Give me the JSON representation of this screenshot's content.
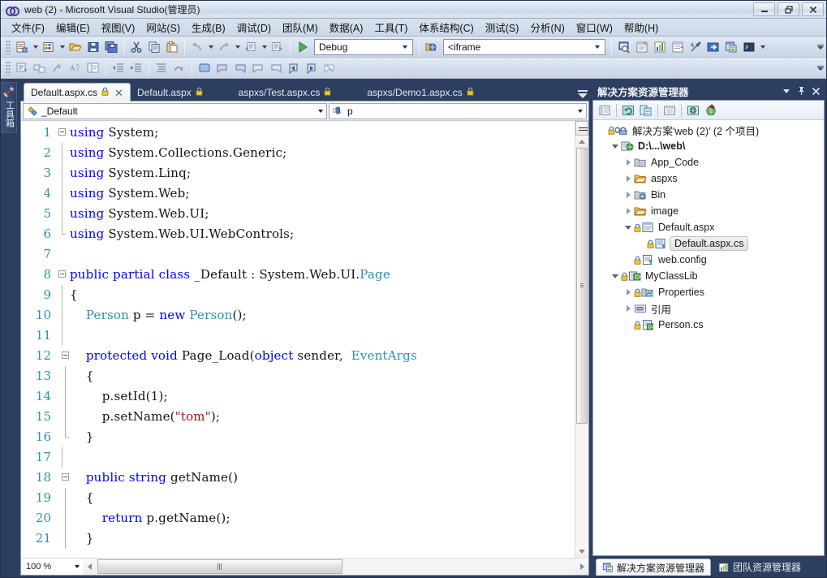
{
  "window": {
    "title": "web (2) - Microsoft Visual Studio(管理员)",
    "logo_icon": "visual-studio-infinity-logo",
    "buttons": [
      {
        "name": "minimize",
        "icon": "minimize-icon",
        "label": "—"
      },
      {
        "name": "restore",
        "icon": "restore-icon",
        "label": "❐"
      },
      {
        "name": "close",
        "icon": "close-icon",
        "label": "✕"
      }
    ]
  },
  "menubar": {
    "items": [
      {
        "label": "文件(F)",
        "name": "menu-file"
      },
      {
        "label": "编辑(E)",
        "name": "menu-edit"
      },
      {
        "label": "视图(V)",
        "name": "menu-view"
      },
      {
        "label": "网站(S)",
        "name": "menu-website"
      },
      {
        "label": "生成(B)",
        "name": "menu-build"
      },
      {
        "label": "调试(D)",
        "name": "menu-debug"
      },
      {
        "label": "团队(M)",
        "name": "menu-team"
      },
      {
        "label": "数据(A)",
        "name": "menu-data"
      },
      {
        "label": "工具(T)",
        "name": "menu-tools"
      },
      {
        "label": "体系结构(C)",
        "name": "menu-architecture"
      },
      {
        "label": "测试(S)",
        "name": "menu-test"
      },
      {
        "label": "分析(N)",
        "name": "menu-analyze"
      },
      {
        "label": "窗口(W)",
        "name": "menu-window"
      },
      {
        "label": "帮助(H)",
        "name": "menu-help"
      }
    ]
  },
  "toolbar_main": {
    "configuration_combo": {
      "value": "Debug",
      "name": "solution-configuration-combo"
    },
    "target_combo": {
      "value": "<iframe",
      "name": "target-browser-combo"
    },
    "icons": [
      "new-project-icon",
      "new-website-icon",
      "open-file-icon",
      "save-icon",
      "save-all-icon",
      "cut-icon",
      "copy-icon",
      "paste-icon",
      "undo-icon",
      "redo-icon",
      "navigate-backward-icon",
      "navigate-forward-icon",
      "start-debugging-icon",
      "view-in-browser-icon",
      "find-in-files-icon",
      "properties-window-icon",
      "toolbox-icon",
      "object-browser-icon",
      "tools-options-icon",
      "step-into-icon",
      "solution-explorer-icon",
      "command-window-icon"
    ]
  },
  "toolbar_secondary": {
    "icons": [
      "display-all-members-icon",
      "insert-snippet-icon",
      "surround-with-icon",
      "comment-selection-icon",
      "uncomment-selection-icon",
      "decrease-indent-icon",
      "increase-indent-icon",
      "toggle-bookmark-icon",
      "clear-bookmarks-icon",
      "toggle-all-outlining-icon",
      "previous-bookmark-icon",
      "next-bookmark-icon",
      "previous-bookmark-in-folder-icon",
      "next-bookmark-in-folder-icon",
      "previous-bookmark-in-document-icon",
      "next-bookmark-in-document-icon",
      "clear-all-bookmarks-icon"
    ]
  },
  "document_tabs": {
    "items": [
      {
        "label": "Default.aspx.cs",
        "active": true,
        "locked": true,
        "closable": true,
        "name": "tab-default-aspx-cs"
      },
      {
        "label": "Default.aspx",
        "active": false,
        "locked": true,
        "closable": false,
        "name": "tab-default-aspx"
      },
      {
        "label": "aspxs/Test.aspx.cs",
        "active": false,
        "locked": true,
        "closable": false,
        "name": "tab-test-aspx-cs"
      },
      {
        "label": "aspxs/Demo1.aspx.cs",
        "active": false,
        "locked": true,
        "closable": false,
        "name": "tab-demo1-aspx-cs"
      }
    ],
    "close_label": "✕",
    "overflow_icon": "tab-overflow-icon"
  },
  "navigation_bar": {
    "type_combo": {
      "value": "_Default",
      "icon": "class-icon",
      "name": "type-navigation-combo"
    },
    "member_combo": {
      "value": "p",
      "icon": "field-icon",
      "name": "member-navigation-combo"
    }
  },
  "editor": {
    "zoom": "100 %",
    "lines": [
      {
        "num": "1",
        "fold": "open-first",
        "tokens": [
          {
            "t": "using",
            "c": "kw"
          },
          {
            "t": " System;",
            "c": "pln"
          }
        ]
      },
      {
        "num": "2",
        "fold": "bar",
        "tokens": [
          {
            "t": "using",
            "c": "kw"
          },
          {
            "t": " System.Collections.Generic;",
            "c": "pln"
          }
        ]
      },
      {
        "num": "3",
        "fold": "bar",
        "tokens": [
          {
            "t": "using",
            "c": "kw"
          },
          {
            "t": " System.Linq;",
            "c": "pln"
          }
        ]
      },
      {
        "num": "4",
        "fold": "bar",
        "tokens": [
          {
            "t": "using",
            "c": "kw"
          },
          {
            "t": " System.Web;",
            "c": "pln"
          }
        ]
      },
      {
        "num": "5",
        "fold": "bar",
        "tokens": [
          {
            "t": "using",
            "c": "kw"
          },
          {
            "t": " System.Web.UI;",
            "c": "pln"
          }
        ]
      },
      {
        "num": "6",
        "fold": "bar-end",
        "tokens": [
          {
            "t": "using",
            "c": "kw"
          },
          {
            "t": " System.Web.UI.WebControls;",
            "c": "pln"
          }
        ]
      },
      {
        "num": "7",
        "fold": "none",
        "tokens": []
      },
      {
        "num": "8",
        "fold": "open",
        "tokens": [
          {
            "t": "public partial class",
            "c": "kw"
          },
          {
            "t": " _Default : System.Web.UI.",
            "c": "pln"
          },
          {
            "t": "Page",
            "c": "type"
          }
        ]
      },
      {
        "num": "9",
        "fold": "bar",
        "tokens": [
          {
            "t": "{",
            "c": "pln"
          }
        ]
      },
      {
        "num": "10",
        "fold": "bar",
        "tokens": [
          {
            "t": "    ",
            "c": "pln"
          },
          {
            "t": "Person",
            "c": "type"
          },
          {
            "t": " p = ",
            "c": "pln"
          },
          {
            "t": "new",
            "c": "kw"
          },
          {
            "t": " ",
            "c": "pln"
          },
          {
            "t": "Person",
            "c": "type"
          },
          {
            "t": "();",
            "c": "pln"
          }
        ]
      },
      {
        "num": "11",
        "fold": "bar",
        "tokens": []
      },
      {
        "num": "12",
        "fold": "open-inner",
        "tokens": [
          {
            "t": "    ",
            "c": "pln"
          },
          {
            "t": "protected void",
            "c": "kw"
          },
          {
            "t": " Page_Load(",
            "c": "pln"
          },
          {
            "t": "object",
            "c": "kw"
          },
          {
            "t": " sender,  ",
            "c": "pln"
          },
          {
            "t": "EventArgs",
            "c": "type"
          }
        ]
      },
      {
        "num": "13",
        "fold": "bar-inner",
        "tokens": [
          {
            "t": "    {",
            "c": "pln"
          }
        ]
      },
      {
        "num": "14",
        "fold": "bar-inner",
        "tokens": [
          {
            "t": "        p.setId(1);",
            "c": "pln"
          }
        ]
      },
      {
        "num": "15",
        "fold": "bar-inner",
        "tokens": [
          {
            "t": "        p.setName(",
            "c": "pln"
          },
          {
            "t": "\"tom\"",
            "c": "str"
          },
          {
            "t": ");",
            "c": "pln"
          }
        ]
      },
      {
        "num": "16",
        "fold": "bar-inner-end",
        "tokens": [
          {
            "t": "    }",
            "c": "pln"
          }
        ]
      },
      {
        "num": "17",
        "fold": "bar",
        "tokens": []
      },
      {
        "num": "18",
        "fold": "open-inner",
        "tokens": [
          {
            "t": "    ",
            "c": "pln"
          },
          {
            "t": "public string",
            "c": "kw"
          },
          {
            "t": " getName()",
            "c": "pln"
          }
        ]
      },
      {
        "num": "19",
        "fold": "bar-inner",
        "tokens": [
          {
            "t": "    {",
            "c": "pln"
          }
        ]
      },
      {
        "num": "20",
        "fold": "bar-inner",
        "tokens": [
          {
            "t": "        ",
            "c": "pln"
          },
          {
            "t": "return",
            "c": "kw"
          },
          {
            "t": " p.getName();",
            "c": "pln"
          }
        ]
      },
      {
        "num": "21",
        "fold": "bar-inner",
        "tokens": [
          {
            "t": "    }",
            "c": "pln"
          }
        ]
      }
    ]
  },
  "solution_explorer": {
    "title": "解决方案资源管理器",
    "header_buttons": [
      {
        "name": "dropdown-button",
        "icon": "chevron-down-icon"
      },
      {
        "name": "auto-hide-button",
        "icon": "pin-icon",
        "label": "⊥"
      },
      {
        "name": "close-button",
        "icon": "close-icon",
        "label": "✕"
      }
    ],
    "toolbar_icons": [
      "properties-icon",
      "refresh-icon",
      "nest-related-files-icon",
      "show-all-files-icon",
      "view-designer-icon",
      "view-in-browser-icon",
      "copy-website-icon",
      "asp-net-configuration-icon"
    ],
    "tree": [
      {
        "label": "解决方案'web (2)' (2 个项目)",
        "depth": 0,
        "expander": "none",
        "icon": "solution-icon",
        "locked": true,
        "bold": false,
        "selected": false
      },
      {
        "label": "D:\\...\\web\\",
        "depth": 1,
        "expander": "open",
        "icon": "web-project-icon",
        "locked": false,
        "bold": true,
        "selected": false
      },
      {
        "label": "App_Code",
        "depth": 2,
        "expander": "closed",
        "icon": "app-code-folder-icon",
        "locked": false,
        "bold": false,
        "selected": false
      },
      {
        "label": "aspxs",
        "depth": 2,
        "expander": "closed",
        "icon": "folder-icon",
        "locked": false,
        "bold": false,
        "selected": false
      },
      {
        "label": "Bin",
        "depth": 2,
        "expander": "closed",
        "icon": "bin-folder-icon",
        "locked": false,
        "bold": false,
        "selected": false
      },
      {
        "label": "image",
        "depth": 2,
        "expander": "closed",
        "icon": "folder-icon",
        "locked": false,
        "bold": false,
        "selected": false
      },
      {
        "label": "Default.aspx",
        "depth": 2,
        "expander": "open",
        "icon": "aspx-file-icon",
        "locked": true,
        "bold": false,
        "selected": false
      },
      {
        "label": "Default.aspx.cs",
        "depth": 3,
        "expander": "none",
        "icon": "csharp-codebehind-icon",
        "locked": true,
        "bold": false,
        "selected": true
      },
      {
        "label": "web.config",
        "depth": 2,
        "expander": "none",
        "icon": "config-file-icon",
        "locked": true,
        "bold": false,
        "selected": false
      },
      {
        "label": "MyClassLib",
        "depth": 1,
        "expander": "open",
        "icon": "csharp-project-icon",
        "locked": true,
        "bold": false,
        "selected": false
      },
      {
        "label": "Properties",
        "depth": 2,
        "expander": "closed",
        "icon": "properties-folder-icon",
        "locked": true,
        "bold": false,
        "selected": false
      },
      {
        "label": "引用",
        "depth": 2,
        "expander": "closed",
        "icon": "references-folder-icon",
        "locked": false,
        "bold": false,
        "selected": false
      },
      {
        "label": "Person.cs",
        "depth": 2,
        "expander": "none",
        "icon": "csharp-file-icon",
        "locked": true,
        "bold": false,
        "selected": false
      }
    ],
    "bottom_tabs": [
      {
        "label": "解决方案资源管理器",
        "active": true,
        "icon": "solution-explorer-icon",
        "name": "tab-solution-explorer"
      },
      {
        "label": "团队资源管理器",
        "active": false,
        "icon": "team-explorer-icon",
        "name": "tab-team-explorer"
      }
    ]
  },
  "toolbox": {
    "label": "工具箱",
    "icon": "toolbox-icon"
  },
  "colors": {
    "chrome": "#2d3e5f",
    "keyword": "#0000ff",
    "type": "#2b91af",
    "string": "#a31515",
    "linenumber": "#2b91af"
  }
}
